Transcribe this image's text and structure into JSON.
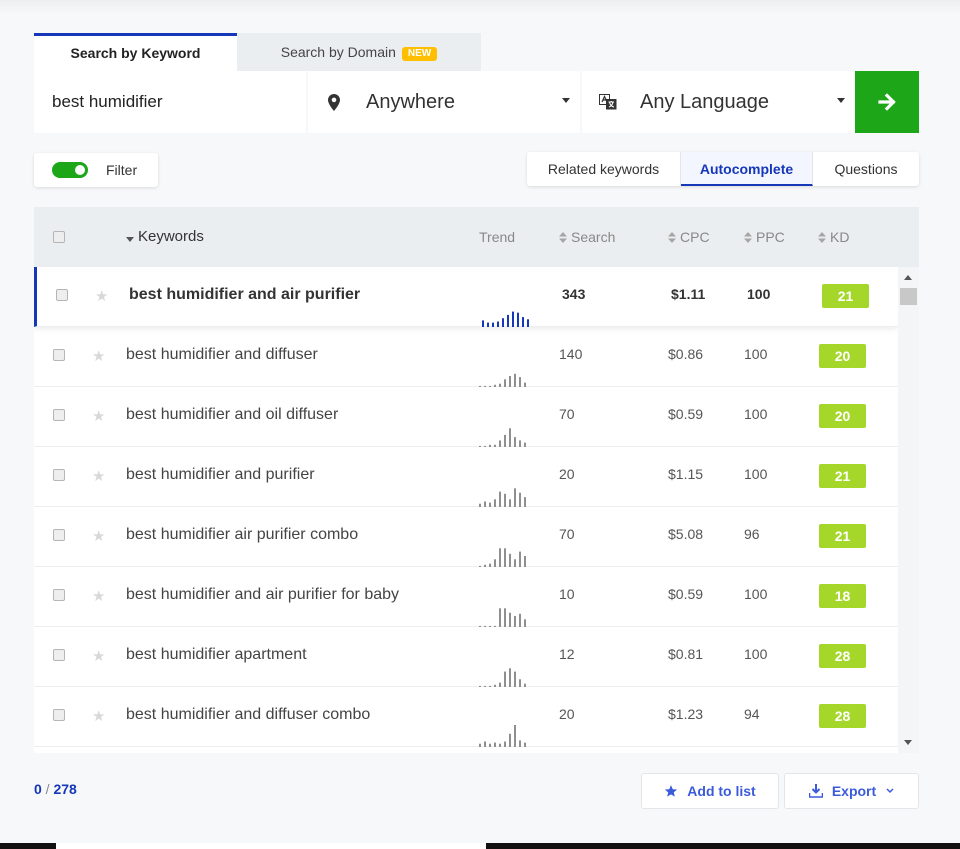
{
  "tabs": {
    "keyword": "Search by Keyword",
    "domain": "Search by Domain",
    "new_badge": "NEW"
  },
  "search": {
    "value": "best humidifier",
    "location": "Anywhere",
    "language": "Any Language"
  },
  "filter": {
    "label": "Filter",
    "enabled": true
  },
  "view_tabs": [
    "Related keywords",
    "Autocomplete",
    "Questions"
  ],
  "active_view": "Autocomplete",
  "columns": {
    "keywords": "Keywords",
    "trend": "Trend",
    "search": "Search",
    "cpc": "CPC",
    "ppc": "PPC",
    "kd": "KD"
  },
  "rows": [
    {
      "keyword": "best humidifier and air purifier",
      "search": "343",
      "cpc": "$1.11",
      "ppc": "100",
      "kd": "21",
      "trend": [
        6,
        4,
        4,
        5,
        8,
        11,
        14,
        13,
        9,
        7
      ]
    },
    {
      "keyword": "best humidifier and diffuser",
      "search": "140",
      "cpc": "$0.86",
      "ppc": "100",
      "kd": "20",
      "trend": [
        1,
        1,
        1,
        2,
        3,
        7,
        10,
        12,
        9,
        4
      ]
    },
    {
      "keyword": "best humidifier and oil diffuser",
      "search": "70",
      "cpc": "$0.59",
      "ppc": "100",
      "kd": "20",
      "trend": [
        1,
        1,
        2,
        2,
        6,
        11,
        17,
        9,
        6,
        4
      ]
    },
    {
      "keyword": "best humidifier and purifier",
      "search": "20",
      "cpc": "$1.15",
      "ppc": "100",
      "kd": "21",
      "trend": [
        3,
        5,
        4,
        7,
        14,
        12,
        7,
        17,
        13,
        9
      ]
    },
    {
      "keyword": "best humidifier air purifier combo",
      "search": "70",
      "cpc": "$5.08",
      "ppc": "96",
      "kd": "21",
      "trend": [
        1,
        2,
        3,
        7,
        17,
        17,
        12,
        7,
        14,
        10
      ]
    },
    {
      "keyword": "best humidifier and air purifier for baby",
      "search": "10",
      "cpc": "$0.59",
      "ppc": "100",
      "kd": "18",
      "trend": [
        1,
        1,
        1,
        1,
        17,
        17,
        13,
        10,
        12,
        7
      ]
    },
    {
      "keyword": "best humidifier apartment",
      "search": "12",
      "cpc": "$0.81",
      "ppc": "100",
      "kd": "28",
      "trend": [
        1,
        1,
        1,
        2,
        4,
        14,
        17,
        14,
        7,
        3
      ]
    },
    {
      "keyword": "best humidifier and diffuser combo",
      "search": "20",
      "cpc": "$1.23",
      "ppc": "94",
      "kd": "28",
      "trend": [
        3,
        5,
        3,
        4,
        3,
        5,
        12,
        20,
        6,
        4
      ]
    }
  ],
  "selection": {
    "selected": "0",
    "total": "278"
  },
  "actions": {
    "add_to_list": "Add to list",
    "export": "Export"
  },
  "colors": {
    "accent": "#1537b8",
    "green": "#1ea619",
    "kd_badge": "#a5d72a",
    "trend_active": "#1537b8",
    "trend": "#8f8f8f"
  },
  "icons": [
    "location-pin-icon",
    "language-icon",
    "arrow-right-icon",
    "star-icon",
    "sort-down-icon",
    "sort-updown-icon",
    "download-icon",
    "chevron-down-icon"
  ]
}
